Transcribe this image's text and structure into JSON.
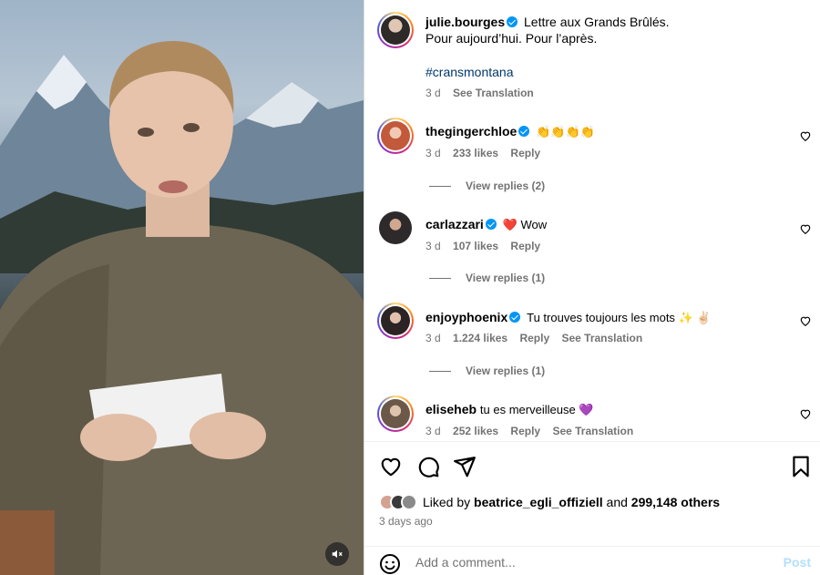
{
  "post": {
    "author": "julie.bourges",
    "caption_line1": "Lettre aux Grands Brûlés.",
    "caption_line2": "Pour aujourd’hui. Pour l’après.",
    "hashtag": "#cransmontana",
    "age": "3 d",
    "see_translation": "See Translation"
  },
  "comments": [
    {
      "username": "thegingerchloe",
      "verified": true,
      "text": "👏👏👏👏",
      "age": "3 d",
      "likes": "233 likes",
      "reply": "Reply",
      "translation": "",
      "view_replies": "View replies (2)",
      "avatar_color": "#c97a6a"
    },
    {
      "username": "carlazzari",
      "verified": true,
      "text": "❤️ Wow",
      "age": "3 d",
      "likes": "107 likes",
      "reply": "Reply",
      "translation": "",
      "view_replies": "View replies (1)",
      "avatar_color": "#3d3a3c"
    },
    {
      "username": "enjoyphoenix",
      "verified": true,
      "text": "Tu trouves toujours les mots ✨ ✌🏻",
      "age": "3 d",
      "likes": "1.224 likes",
      "reply": "Reply",
      "translation": "See Translation",
      "view_replies": "View replies (1)",
      "avatar_color": "#5a4a4a"
    },
    {
      "username": "eliseheb",
      "verified": false,
      "text": "tu es merveilleuse 💜",
      "age": "3 d",
      "likes": "252 likes",
      "reply": "Reply",
      "translation": "See Translation",
      "view_replies": "",
      "avatar_color": "#7a6a5a"
    }
  ],
  "likes_bar": {
    "prefix": "Liked by",
    "liker": "beatrice_egli_offiziell",
    "middle": "and",
    "others": "299,148 others",
    "date": "3 days ago"
  },
  "comment_box": {
    "placeholder": "Add a comment...",
    "post_label": "Post"
  },
  "icons": [
    "heart-icon",
    "comment-icon",
    "share-icon",
    "bookmark-icon",
    "emoji-icon",
    "mute-icon",
    "verified-icon"
  ],
  "colors": {
    "verified": "#0095f6",
    "hashtag": "#00376b",
    "post_disabled": "#b2dffc",
    "meta": "#737373"
  }
}
